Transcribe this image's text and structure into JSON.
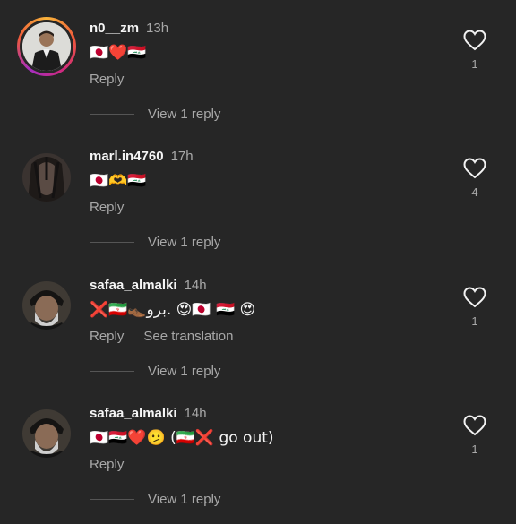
{
  "comments": [
    {
      "username": "n0__zm",
      "time": "13h",
      "text": "🇯🇵❤️🇮🇶",
      "reply_label": "Reply",
      "likes": "1",
      "view_replies": "View 1 reply"
    },
    {
      "username": "marl.in4760",
      "time": "17h",
      "text": "🇯🇵🫶🇮🇶",
      "reply_label": "Reply",
      "likes": "4",
      "view_replies": "View 1 reply"
    },
    {
      "username": "safaa_almalki",
      "time": "14h",
      "text": "❌🇮🇷👞برو. 😍🇯🇵 🇮🇶 😍",
      "reply_label": "Reply",
      "translate_label": "See translation",
      "likes": "1",
      "view_replies": "View 1 reply"
    },
    {
      "username": "safaa_almalki",
      "time": "14h",
      "text": "🇯🇵🇮🇶❤️🫤 (🇮🇷❌ go out)",
      "reply_label": "Reply",
      "likes": "1",
      "view_replies": "View 1 reply"
    }
  ],
  "colors": {
    "background": "#262626",
    "secondary_text": "#a8a8a8",
    "primary_text": "#f5f5f5"
  }
}
